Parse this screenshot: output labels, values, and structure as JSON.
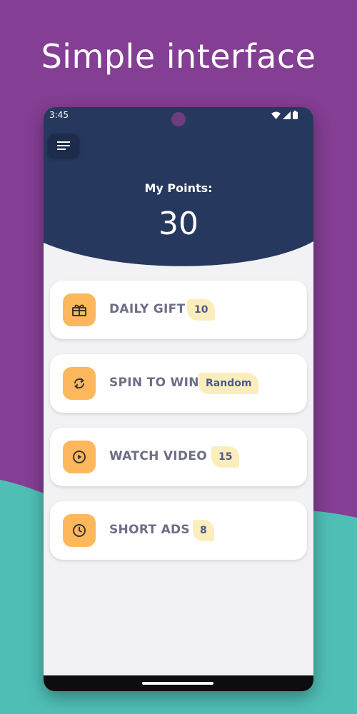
{
  "promo": {
    "headline": "Simple interface"
  },
  "status_bar": {
    "time": "3:45"
  },
  "header": {
    "points_label": "My Points:",
    "points_value": "30"
  },
  "cards": [
    {
      "title": "DAILY GIFT",
      "badge": "10",
      "icon": "gift-icon"
    },
    {
      "title": "SPIN TO WIN",
      "badge": "Random",
      "icon": "refresh-icon"
    },
    {
      "title": "WATCH VIDEO",
      "badge": "15",
      "icon": "play-icon"
    },
    {
      "title": "SHORT ADS",
      "badge": "8",
      "icon": "clock-icon"
    }
  ],
  "colors": {
    "background": "#843e94",
    "wave": "#4fbfb6",
    "header": "#27385e",
    "icon_bg": "#fdb85d",
    "badge_bg": "#fbeebc"
  }
}
